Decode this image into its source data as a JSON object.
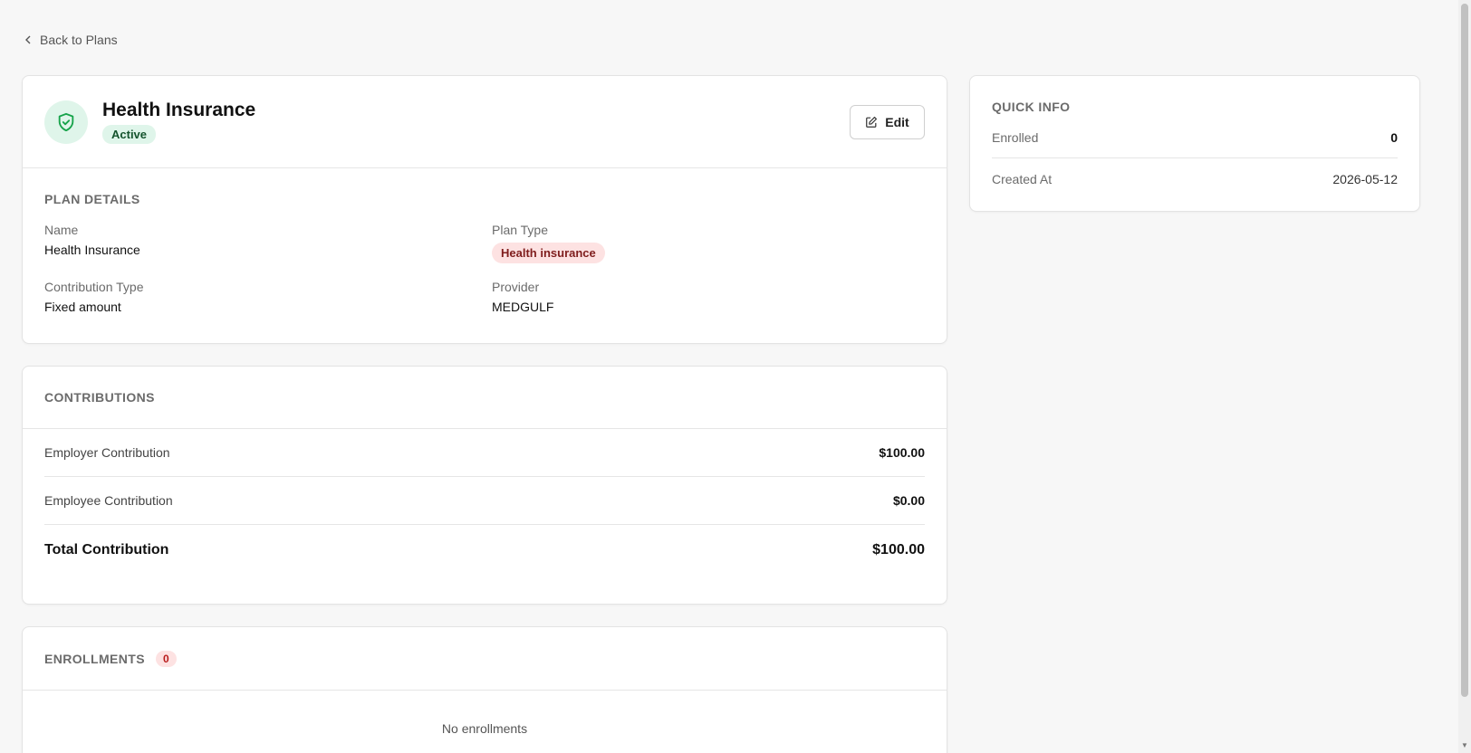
{
  "nav": {
    "back_label": "Back to Plans"
  },
  "plan": {
    "title": "Health Insurance",
    "status": "Active",
    "edit_label": "Edit"
  },
  "details": {
    "section_title": "PLAN DETAILS",
    "fields": [
      {
        "label": "Name",
        "value": "Health Insurance"
      },
      {
        "label": "Plan Type",
        "value": "Health insurance"
      },
      {
        "label": "Contribution Type",
        "value": "Fixed amount"
      },
      {
        "label": "Provider",
        "value": "MEDGULF"
      }
    ]
  },
  "contributions": {
    "section_title": "CONTRIBUTIONS",
    "rows": [
      {
        "label": "Employer Contribution",
        "value": "$100.00"
      },
      {
        "label": "Employee Contribution",
        "value": "$0.00"
      }
    ],
    "total": {
      "label": "Total Contribution",
      "value": "$100.00"
    }
  },
  "enrollments": {
    "section_title": "ENROLLMENTS",
    "count": "0",
    "empty_text": "No enrollments"
  },
  "quick_info": {
    "section_title": "QUICK INFO",
    "enrolled": {
      "label": "Enrolled",
      "value": "0"
    },
    "created": {
      "label": "Created At",
      "value": "2026-05-12"
    }
  },
  "colors": {
    "accent_green": "#16a34a",
    "status_bg": "#dff5ea",
    "type_badge_bg": "#fde2e2"
  },
  "icons": {
    "back": "chevron-left-icon",
    "plan": "shield-check-icon",
    "edit": "edit-icon"
  }
}
